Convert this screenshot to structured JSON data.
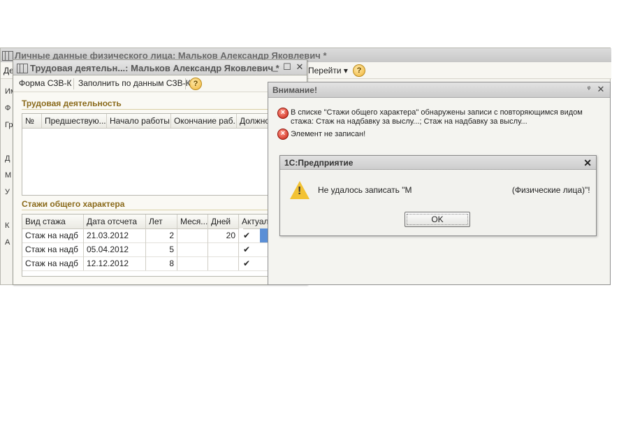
{
  "bg_window": {
    "title": "Личные данные физического лица: Мальков Александр Яковлевич *",
    "toolbar_left": "Де",
    "goto_label": "Перейти ▾",
    "side_items": [
      "Им",
      "Ф",
      "Гр",
      "Д",
      "М",
      "У",
      "К",
      "А"
    ]
  },
  "work_window": {
    "title": "Трудовая деятельн...: Мальков Александр Яковлевич *",
    "toolbar": {
      "form_btn": "Форма СЗВ-К",
      "fill_btn": "Заполнить по данным СЗВ-К",
      "help": "?"
    },
    "section1_title": "Трудовая деятельность",
    "grid1_headers": [
      "№",
      "Предшествую...",
      "Начало работы",
      "Окончание раб...",
      "Должно"
    ],
    "section2_title": "Стажи общего характера",
    "grid2_headers": [
      "Вид стажа",
      "Дата отсчета",
      "Лет",
      "Меся...",
      "Дней",
      "Актуаль"
    ],
    "grid2_rows": [
      {
        "type": "Стаж на надб",
        "date": "21.03.2012",
        "years": "2",
        "months": "",
        "days": "20",
        "actual": "✔"
      },
      {
        "type": "Стаж на надб",
        "date": "05.04.2012",
        "years": "5",
        "months": "",
        "days": "",
        "actual": "✔"
      },
      {
        "type": "Стаж на надб",
        "date": "12.12.2012",
        "years": "8",
        "months": "",
        "days": "",
        "actual": "✔"
      }
    ],
    "controls": {
      "minimize": "_",
      "maximize": "☐",
      "close": "✕",
      "pin": "*"
    }
  },
  "warning_window": {
    "title": "Внимание!",
    "messages": [
      {
        "line1": "В списке \"Стажи общего характера\" обнаружены записи с повторяющимся видом",
        "line2": "стажа: Стаж на надбавку за выслу...; Стаж на надбавку за выслу..."
      },
      {
        "line1": "Элемент не записан!"
      }
    ],
    "controls": {
      "pin": "ᵠ",
      "close": "✕"
    }
  },
  "modal": {
    "title": "1С:Предприятие",
    "message": "Не удалось записать \"М                                           (Физические лица)\"!",
    "ok_label": "OK",
    "close": "✕"
  },
  "colors": {
    "section_title": "#8a6a1a",
    "selected_cell": "#5b8fd6",
    "error_icon": "#c81e10",
    "warning_icon": "#f2c234"
  }
}
